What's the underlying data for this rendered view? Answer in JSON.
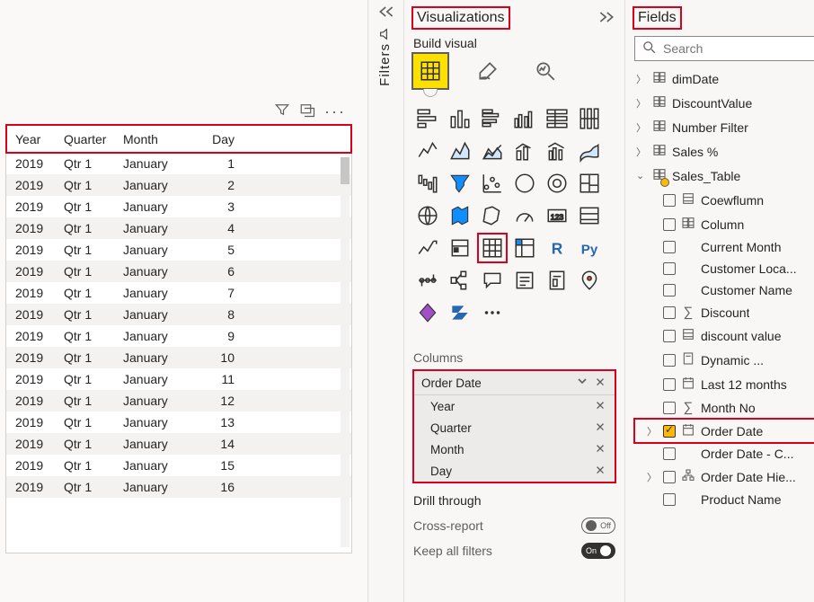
{
  "canvas": {
    "table": {
      "headers": [
        "Year",
        "Quarter",
        "Month",
        "Day"
      ],
      "rows": [
        {
          "year": "2019",
          "quarter": "Qtr 1",
          "month": "January",
          "day": "1"
        },
        {
          "year": "2019",
          "quarter": "Qtr 1",
          "month": "January",
          "day": "2"
        },
        {
          "year": "2019",
          "quarter": "Qtr 1",
          "month": "January",
          "day": "3"
        },
        {
          "year": "2019",
          "quarter": "Qtr 1",
          "month": "January",
          "day": "4"
        },
        {
          "year": "2019",
          "quarter": "Qtr 1",
          "month": "January",
          "day": "5"
        },
        {
          "year": "2019",
          "quarter": "Qtr 1",
          "month": "January",
          "day": "6"
        },
        {
          "year": "2019",
          "quarter": "Qtr 1",
          "month": "January",
          "day": "7"
        },
        {
          "year": "2019",
          "quarter": "Qtr 1",
          "month": "January",
          "day": "8"
        },
        {
          "year": "2019",
          "quarter": "Qtr 1",
          "month": "January",
          "day": "9"
        },
        {
          "year": "2019",
          "quarter": "Qtr 1",
          "month": "January",
          "day": "10"
        },
        {
          "year": "2019",
          "quarter": "Qtr 1",
          "month": "January",
          "day": "11"
        },
        {
          "year": "2019",
          "quarter": "Qtr 1",
          "month": "January",
          "day": "12"
        },
        {
          "year": "2019",
          "quarter": "Qtr 1",
          "month": "January",
          "day": "13"
        },
        {
          "year": "2019",
          "quarter": "Qtr 1",
          "month": "January",
          "day": "14"
        },
        {
          "year": "2019",
          "quarter": "Qtr 1",
          "month": "January",
          "day": "15"
        },
        {
          "year": "2019",
          "quarter": "Qtr 1",
          "month": "January",
          "day": "16"
        }
      ]
    }
  },
  "filters": {
    "label": "Filters"
  },
  "viz": {
    "title": "Visualizations",
    "build_label": "Build visual",
    "columns_label": "Columns",
    "well": {
      "header": "Order Date",
      "items": [
        "Year",
        "Quarter",
        "Month",
        "Day"
      ]
    },
    "drill_label": "Drill through",
    "cross_report_label": "Cross-report",
    "cross_report_state": "Off",
    "keep_filters_label": "Keep all filters",
    "keep_filters_state": "On"
  },
  "fields": {
    "title": "Fields",
    "search_placeholder": "Search",
    "tables": [
      {
        "name": "dimDate",
        "expanded": false
      },
      {
        "name": "DiscountValue",
        "expanded": false
      },
      {
        "name": "Number Filter",
        "expanded": false,
        "warning": true
      },
      {
        "name": "Sales %",
        "expanded": false
      }
    ],
    "sales_table": {
      "name": "Sales_Table",
      "fields": [
        {
          "name": "Coewflumn",
          "icon": "column"
        },
        {
          "name": "Column",
          "icon": "table"
        },
        {
          "name": "Current Month",
          "icon": ""
        },
        {
          "name": "Customer Loca...",
          "icon": ""
        },
        {
          "name": "Customer Name",
          "icon": ""
        },
        {
          "name": "Discount",
          "icon": "sigma"
        },
        {
          "name": "discount value",
          "icon": "column"
        },
        {
          "name": "Dynamic ...",
          "icon": "calc",
          "warning": true
        },
        {
          "name": "Last 12 months",
          "icon": "date"
        },
        {
          "name": "Month No",
          "icon": "sigma"
        },
        {
          "name": "Order Date",
          "icon": "date",
          "checked": true,
          "expandable": true,
          "highlight": true
        },
        {
          "name": "Order Date - C...",
          "icon": ""
        },
        {
          "name": "Order Date Hie...",
          "icon": "hierarchy",
          "expandable": true
        },
        {
          "name": "Product Name",
          "icon": ""
        }
      ]
    }
  }
}
